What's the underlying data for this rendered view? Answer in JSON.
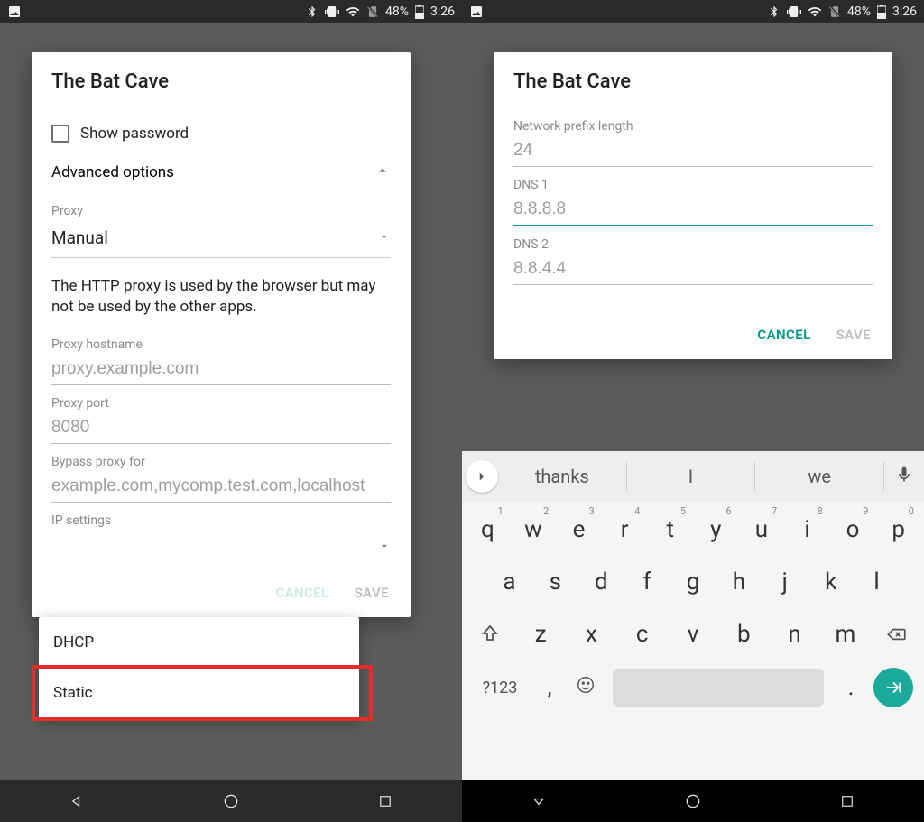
{
  "status": {
    "battery": "48%",
    "time": "3:26"
  },
  "left": {
    "title": "The Bat Cave",
    "show_password_label": "Show password",
    "advanced_label": "Advanced options",
    "proxy_label": "Proxy",
    "proxy_value": "Manual",
    "proxy_info": "The HTTP proxy is used by the browser but may not be used by the other apps.",
    "hostname_label": "Proxy hostname",
    "hostname_ph": "proxy.example.com",
    "port_label": "Proxy port",
    "port_ph": "8080",
    "bypass_label": "Bypass proxy for",
    "bypass_ph": "example.com,mycomp.test.com,localhost",
    "ip_label": "IP settings",
    "dropdown": {
      "dhcp": "DHCP",
      "static": "Static"
    },
    "cancel": "CANCEL",
    "save": "SAVE"
  },
  "right": {
    "title": "The Bat Cave",
    "prefix_label": "Network prefix length",
    "prefix_value": "24",
    "dns1_label": "DNS 1",
    "dns1_ph": "8.8.8.8",
    "dns2_label": "DNS 2",
    "dns2_ph": "8.8.4.4",
    "cancel": "CANCEL",
    "save": "SAVE"
  },
  "keyboard": {
    "suggestions": [
      "thanks",
      "I",
      "we"
    ],
    "row1": [
      "q",
      "w",
      "e",
      "r",
      "t",
      "y",
      "u",
      "i",
      "o",
      "p"
    ],
    "nums": [
      "1",
      "2",
      "3",
      "4",
      "5",
      "6",
      "7",
      "8",
      "9",
      "0"
    ],
    "row2": [
      "a",
      "s",
      "d",
      "f",
      "g",
      "h",
      "j",
      "k",
      "l"
    ],
    "row3": [
      "z",
      "x",
      "c",
      "v",
      "b",
      "n",
      "m"
    ],
    "sym": "?123",
    "comma": ",",
    "period": "."
  }
}
